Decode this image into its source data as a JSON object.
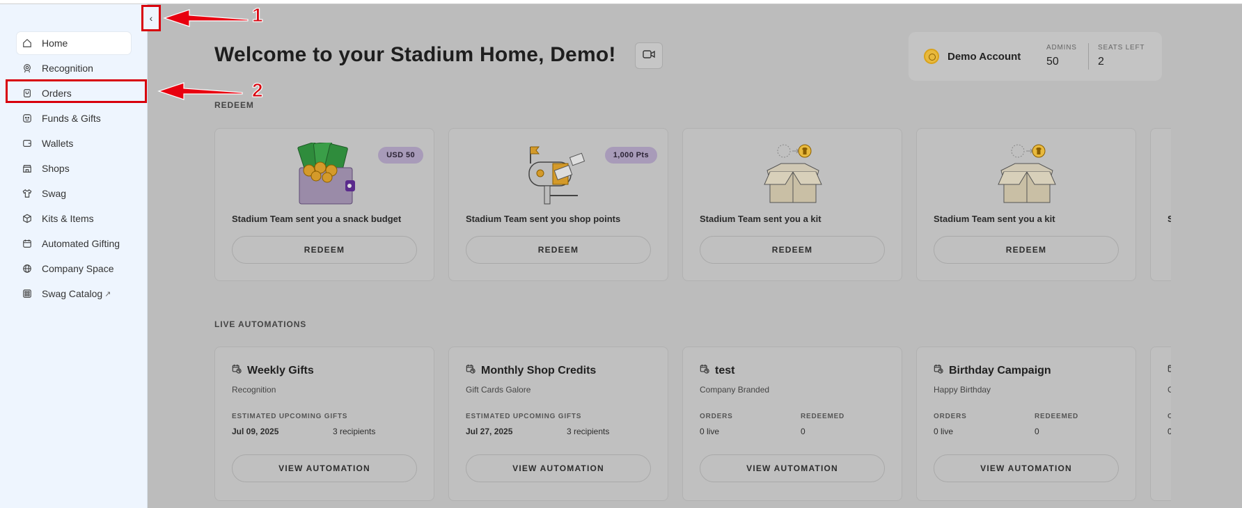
{
  "sidebar": {
    "items": [
      {
        "label": "Home",
        "icon": "home-icon",
        "active": true
      },
      {
        "label": "Recognition",
        "icon": "award-icon",
        "active": false
      },
      {
        "label": "Orders",
        "icon": "orders-icon",
        "active": false
      },
      {
        "label": "Funds & Gifts",
        "icon": "gift-icon",
        "active": false
      },
      {
        "label": "Wallets",
        "icon": "wallet-icon",
        "active": false
      },
      {
        "label": "Shops",
        "icon": "shop-icon",
        "active": false
      },
      {
        "label": "Swag",
        "icon": "tshirt-icon",
        "active": false
      },
      {
        "label": "Kits & Items",
        "icon": "box-icon",
        "active": false
      },
      {
        "label": "Automated Gifting",
        "icon": "calendar-icon",
        "active": false
      },
      {
        "label": "Company Space",
        "icon": "globe-icon",
        "active": false
      },
      {
        "label": "Swag Catalog",
        "icon": "catalog-icon",
        "active": false,
        "external": "↗"
      }
    ],
    "collapse_glyph": "‹"
  },
  "header": {
    "title": "Welcome to your Stadium Home, Demo!",
    "account": {
      "name": "Demo Account",
      "admins_label": "ADMINS",
      "admins_value": "50",
      "seats_label": "SEATS LEFT",
      "seats_value": "2"
    }
  },
  "redeem": {
    "section_label": "REDEEM",
    "cards": [
      {
        "caption": "Stadium Team sent you a snack budget",
        "badge": "USD 50",
        "button": "REDEEM",
        "illustration": "wallet-money-illustration"
      },
      {
        "caption": "Stadium Team sent you shop points",
        "badge": "1,000 Pts",
        "button": "REDEEM",
        "illustration": "mailbox-illustration"
      },
      {
        "caption": "Stadium Team sent you a kit",
        "badge": "",
        "button": "REDEEM",
        "illustration": "kit-box-illustration"
      },
      {
        "caption": "Stadium Team sent you a kit",
        "badge": "",
        "button": "REDEEM",
        "illustration": "kit-box-illustration"
      }
    ],
    "partial_caption": "S"
  },
  "automations": {
    "section_label": "LIVE AUTOMATIONS",
    "cards": [
      {
        "title": "Weekly Gifts",
        "subtitle": "Recognition",
        "label_a": "ESTIMATED UPCOMING GIFTS",
        "label_b": "",
        "value_a": "Jul 09, 2025",
        "value_b": "3 recipients",
        "button": "VIEW AUTOMATION"
      },
      {
        "title": "Monthly Shop Credits",
        "subtitle": "Gift Cards Galore",
        "label_a": "ESTIMATED UPCOMING GIFTS",
        "label_b": "",
        "value_a": "Jul 27, 2025",
        "value_b": "3 recipients",
        "button": "VIEW AUTOMATION"
      },
      {
        "title": "test",
        "subtitle": "Company Branded",
        "label_a": "ORDERS",
        "label_b": "REDEEMED",
        "value_a": "0 live",
        "value_b": "0",
        "button": "VIEW AUTOMATION"
      },
      {
        "title": "Birthday Campaign",
        "subtitle": "Happy Birthday",
        "label_a": "ORDERS",
        "label_b": "REDEEMED",
        "value_a": "0 live",
        "value_b": "0",
        "button": "VIEW AUTOMATION"
      }
    ],
    "partial_sub": "C",
    "partial_label": "O",
    "partial_value": "0"
  },
  "annotations": {
    "one": "1",
    "two": "2",
    "color": "#d8000c"
  }
}
